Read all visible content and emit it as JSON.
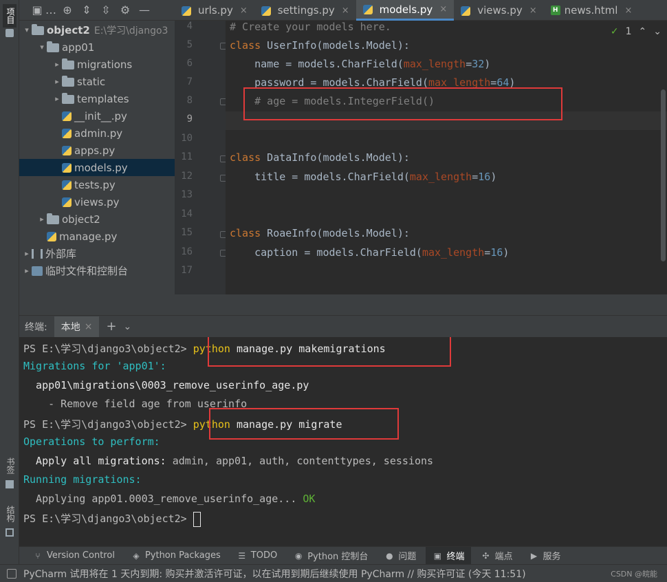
{
  "left_strip": {
    "project_label": "项目",
    "bookmarks_label": "书签",
    "structure_label": "结构"
  },
  "project_toolbar": {
    "ellipsis": "…"
  },
  "tree": [
    {
      "label": "object2",
      "hint": "E:\\学习\\django3",
      "chevron": "▾",
      "icon": "folder",
      "bold": true
    },
    {
      "label": "app01",
      "chevron": "▾",
      "icon": "folder"
    },
    {
      "label": "migrations",
      "chevron": "▸",
      "icon": "folder"
    },
    {
      "label": "static",
      "chevron": "▸",
      "icon": "folder"
    },
    {
      "label": "templates",
      "chevron": "▸",
      "icon": "folder"
    },
    {
      "label": "__init__.py",
      "chevron": "",
      "icon": "python"
    },
    {
      "label": "admin.py",
      "chevron": "",
      "icon": "python"
    },
    {
      "label": "apps.py",
      "chevron": "",
      "icon": "python"
    },
    {
      "label": "models.py",
      "chevron": "",
      "icon": "python",
      "selected": true
    },
    {
      "label": "tests.py",
      "chevron": "",
      "icon": "python"
    },
    {
      "label": "views.py",
      "chevron": "",
      "icon": "python"
    },
    {
      "label": "object2",
      "chevron": "▸",
      "icon": "folder"
    },
    {
      "label": "manage.py",
      "chevron": "",
      "icon": "python"
    },
    {
      "label": "外部库",
      "chevron": "▸",
      "icon": "library"
    },
    {
      "label": "临时文件和控制台",
      "chevron": "▸",
      "icon": "scratch"
    }
  ],
  "tabs": [
    {
      "label": "urls.py",
      "icon": "python"
    },
    {
      "label": "settings.py",
      "icon": "python"
    },
    {
      "label": "models.py",
      "icon": "python",
      "active": true
    },
    {
      "label": "views.py",
      "icon": "python"
    },
    {
      "label": "news.html",
      "icon": "html",
      "icon_text": "H"
    }
  ],
  "tab_close": "×",
  "inspection": {
    "count": "1"
  },
  "editor": {
    "line_numbers": [
      "4",
      "5",
      "6",
      "7",
      "8",
      "9",
      "10",
      "11",
      "12",
      "13",
      "14",
      "15",
      "16",
      "17"
    ],
    "l4": "# Create your models here.",
    "l5": {
      "kw": "class",
      "name": " UserInfo(models.Model):"
    },
    "l6": {
      "pre": "    name = models.CharField(",
      "param": "max_length",
      "eq": "=",
      "num": "32",
      "post": ")"
    },
    "l7": {
      "pre": "    password = models.CharField(",
      "param": "max_length",
      "eq": "=",
      "num": "64",
      "post": ")"
    },
    "l8": "    # age = models.IntegerField()",
    "l11": {
      "kw": "class",
      "name": " DataInfo(models.Model):"
    },
    "l12": {
      "pre": "    title = models.CharField(",
      "param": "max_length",
      "eq": "=",
      "num": "16",
      "post": ")"
    },
    "l15": {
      "kw": "class",
      "name": " RoaeInfo(models.Model):"
    },
    "l16": {
      "pre": "    caption = models.CharField(",
      "param": "max_length",
      "eq": "=",
      "num": "16",
      "post": ")"
    }
  },
  "terminal": {
    "label": "终端:",
    "tab": "本地",
    "prompt": "PS E:\\学习\\django3\\object2> ",
    "cmd1": "python",
    "cmd1_rest": " manage.py makemigrations",
    "mig_for": "Migrations for 'app01':",
    "mig_file": "  app01\\migrations\\0003_remove_userinfo_age.py",
    "mig_op": "    - Remove field age from userinfo",
    "cmd2": "python",
    "cmd2_rest": " manage.py migrate",
    "ops": "Operations to perform:",
    "apply_label": "  Apply all migrations:",
    "apply_list": " admin, app01, auth, contenttypes, sessions",
    "running": "Running migrations:",
    "applying": "  Applying app01.0003_remove_userinfo_age...",
    "ok": " OK"
  },
  "tool_windows": [
    {
      "label": "Version Control",
      "icon": "⑂"
    },
    {
      "label": "Python Packages",
      "icon": "◈"
    },
    {
      "label": "TODO",
      "icon": "☰"
    },
    {
      "label": "Python 控制台",
      "icon": "◉"
    },
    {
      "label": "问题",
      "icon": "●"
    },
    {
      "label": "终端",
      "icon": "▣",
      "active": true
    },
    {
      "label": "端点",
      "icon": "✣"
    },
    {
      "label": "服务",
      "icon": "▶"
    }
  ],
  "status": {
    "message": "PyCharm 试用将在 1 天内到期: 购买并激活许可证，以在试用到期后继续使用 PyCharm // 购买许可证 (今天 11:51)",
    "watermark": "CSDN @皖能"
  },
  "colors": {
    "accent": "#4a88c7",
    "highlight_box": "#e03a3a",
    "terminal_teal": "#2fbfc2",
    "command_yellow": "#e8c21a"
  }
}
